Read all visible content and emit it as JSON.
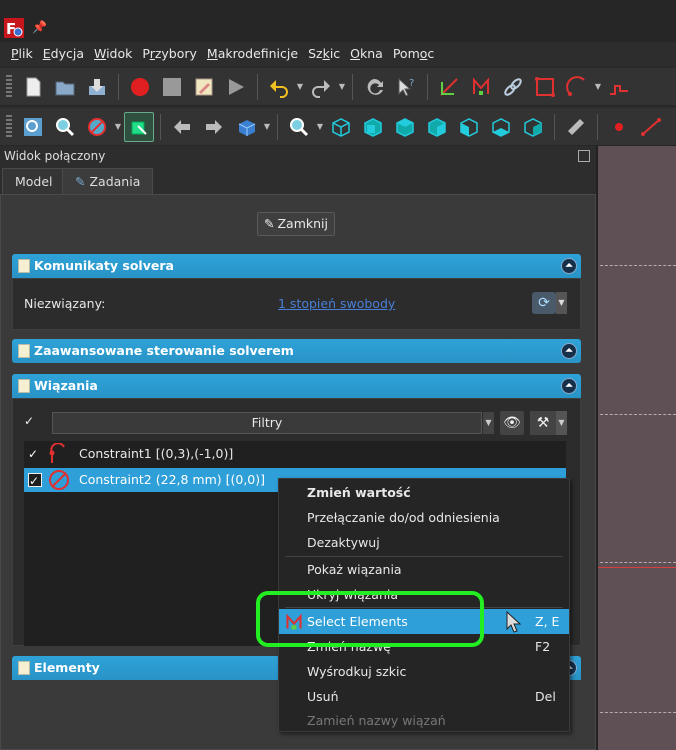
{
  "app": {
    "icon": "freecad-app-icon",
    "pin_icon": "pin-icon"
  },
  "menu": [
    {
      "pre": "",
      "u": "P",
      "post": "lik"
    },
    {
      "pre": "",
      "u": "E",
      "post": "dycja"
    },
    {
      "pre": "",
      "u": "W",
      "post": "idok"
    },
    {
      "pre": "P",
      "u": "r",
      "post": "zybory"
    },
    {
      "pre": "",
      "u": "M",
      "post": "akrodefinicje"
    },
    {
      "pre": "Sz",
      "u": "k",
      "post": "ic"
    },
    {
      "pre": "",
      "u": "O",
      "post": "kna"
    },
    {
      "pre": "Pom",
      "u": "o",
      "post": "c"
    }
  ],
  "combo_view": {
    "title": "Widok połączony",
    "tabs": [
      "Model",
      "Zadania"
    ]
  },
  "task_panel": {
    "close_label": "Zamknij",
    "solver_messages": {
      "title": "Komunikaty solvera",
      "status_label": "Niezwiązany:",
      "status_link": "1 stopień swobody"
    },
    "advanced_title": "Zaawansowane sterowanie solverem",
    "constraints": {
      "title": "Wiązania",
      "filter_label": "Filtry",
      "items": [
        {
          "label": "Constraint1 [(0,3),(-1,0)]",
          "checked": "✓",
          "selected": false,
          "icon": "tangent-constraint-icon"
        },
        {
          "label": "Constraint2 (22,8 mm) [(0,0)]",
          "checked": "✓",
          "selected": true,
          "icon": "diameter-constraint-icon"
        }
      ]
    },
    "elements_title": "Elementy"
  },
  "context_menu": {
    "items": [
      {
        "label": "Zmień wartość",
        "shortcut": "",
        "bold": true
      },
      {
        "label": "Przełączanie do/od odniesienia",
        "shortcut": ""
      },
      {
        "label": "Dezaktywuj",
        "shortcut": ""
      },
      {
        "label": "Pokaż wiązania",
        "shortcut": ""
      },
      {
        "label": "Ukryj wiązania",
        "shortcut": ""
      },
      {
        "label": "Select Elements",
        "shortcut": "Z, E",
        "highlighted": true,
        "icon": "select-elements-icon"
      },
      {
        "label": "Zmień nazwę",
        "shortcut": "F2"
      },
      {
        "label": "Wyśrodkuj szkic",
        "shortcut": ""
      },
      {
        "label": "Usuń",
        "shortcut": "Del"
      },
      {
        "label": "Zamień nazwy wiązań",
        "shortcut": "",
        "disabled": true
      }
    ]
  },
  "colors": {
    "accent": "#2e9fd8",
    "highlight_ring": "#22ee22",
    "viewport_bg": "#5f5055"
  }
}
